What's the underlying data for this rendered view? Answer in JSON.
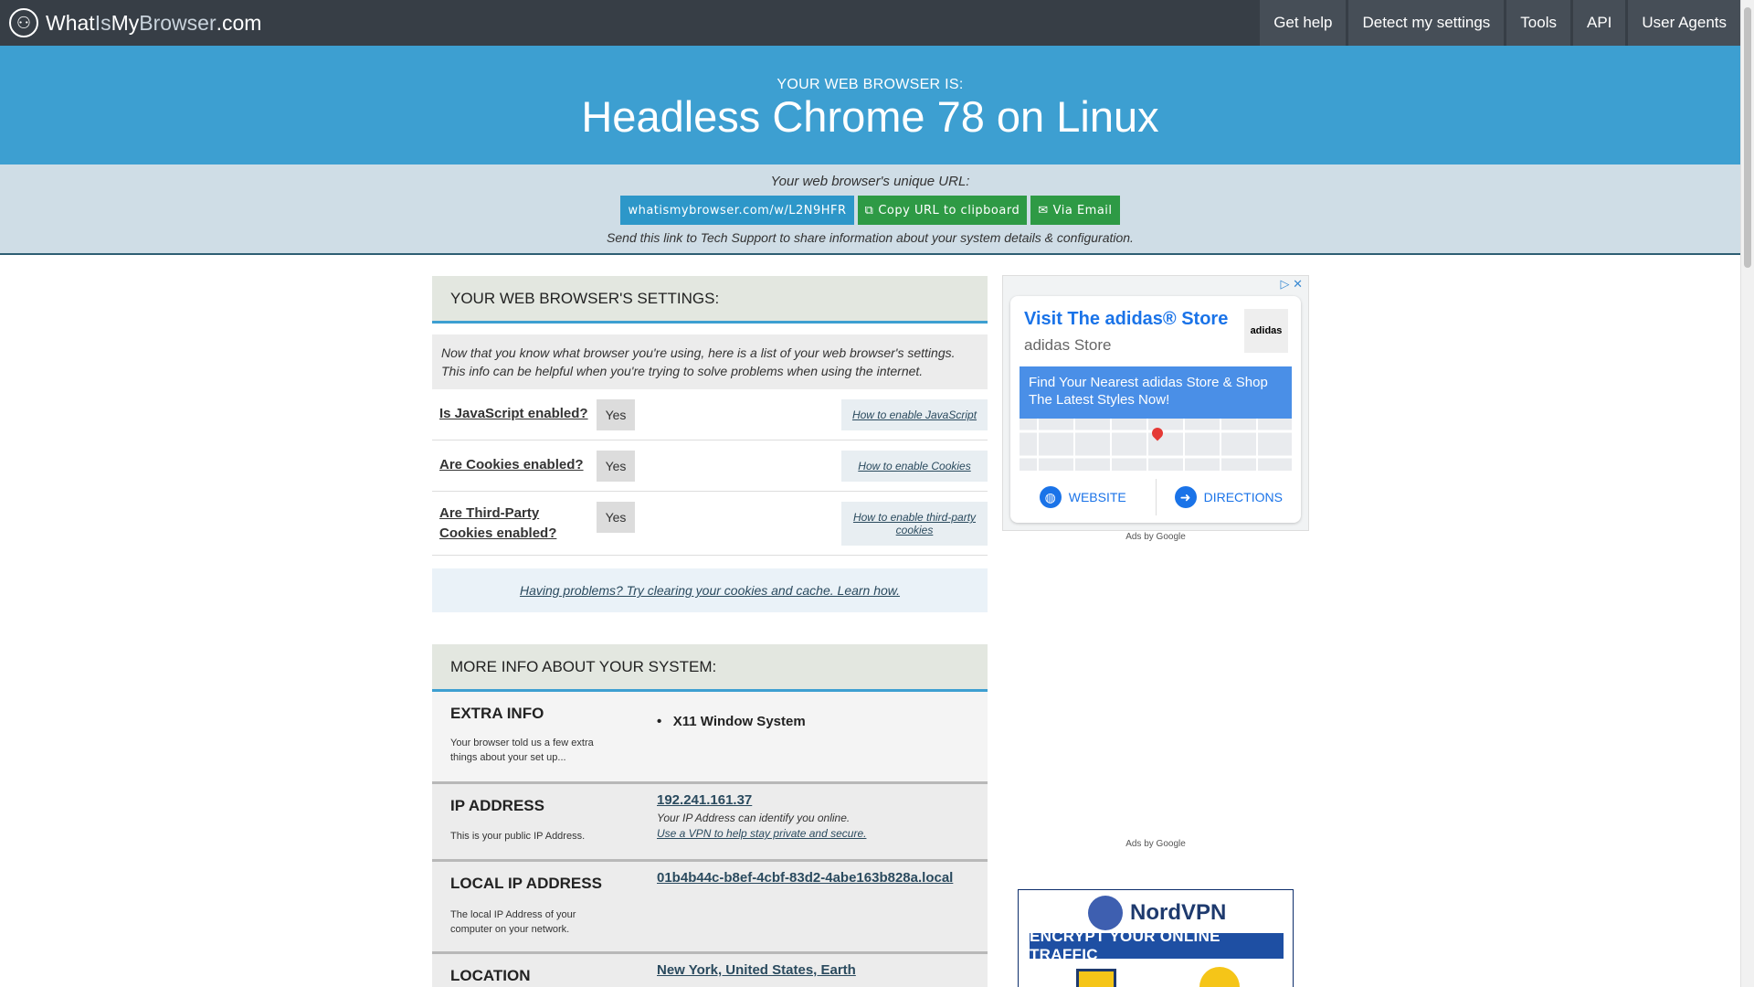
{
  "nav": {
    "brand_parts": [
      "What",
      "Is",
      "My",
      "Browser",
      ".com"
    ],
    "links": [
      "Get help",
      "Detect my settings",
      "Tools",
      "API",
      "User Agents"
    ]
  },
  "hero": {
    "label": "YOUR WEB BROWSER IS:",
    "browser": "Headless Chrome 78 on Linux"
  },
  "share": {
    "title": "Your web browser's unique URL:",
    "url": "whatismybrowser.com/w/L2N9HFR",
    "copy_label": "Copy URL to clipboard",
    "email_label": "Via Email",
    "note": "Send this link to Tech Support to share information about your system details & configuration."
  },
  "settings": {
    "heading": "YOUR WEB BROWSER'S SETTINGS:",
    "intro_line1": "Now that you know what browser you're using, here is a list of your web browser's settings.",
    "intro_line2": "This info can be helpful when you're trying to solve problems when using the internet.",
    "rows": [
      {
        "question": "Is JavaScript enabled?",
        "answer": "Yes",
        "help": "How to enable JavaScript"
      },
      {
        "question": "Are Cookies enabled?",
        "answer": "Yes",
        "help": "How to enable Cookies"
      },
      {
        "question": "Are Third-Party Cookies enabled?",
        "answer": "Yes",
        "help": "How to enable third-party cookies"
      }
    ],
    "problems": "Having problems? Try clearing your cookies and cache. Learn how."
  },
  "more_info": {
    "heading": "MORE INFO ABOUT YOUR SYSTEM:",
    "extra": {
      "title": "EXTRA INFO",
      "desc": "Your browser told us a few extra things about your set up...",
      "bullet": "X11 Window System"
    },
    "ip": {
      "title": "IP ADDRESS",
      "desc": "This is your public IP Address.",
      "value": "192.241.161.37",
      "sub": "Your IP Address can identify you online.",
      "link": "Use a VPN to help stay private and secure."
    },
    "local_ip": {
      "title": "LOCAL IP ADDRESS",
      "desc": "The local IP Address of your computer on your network.",
      "value": "01b4b44c-b8ef-4cbf-83d2-4abe163b828a.local"
    },
    "location": {
      "title": "LOCATION",
      "value": "New York, United States, Earth"
    }
  },
  "ad": {
    "title": "Visit The adidas® Store",
    "advertiser": "adidas Store",
    "logo_text": "adidas",
    "headline": "Find Your Nearest adidas Store & Shop The Latest Styles Now!",
    "website": "WEBSITE",
    "directions": "DIRECTIONS",
    "ads_by": "Ads by Google"
  },
  "nord": {
    "brand": "NordVPN",
    "banner": "ENCRYPT YOUR ONLINE TRAFFIC"
  },
  "colors": {
    "nav": "#373e46",
    "hero": "#3d9fd1",
    "share_bg": "#cfdde6",
    "green": "#2e9a45"
  }
}
